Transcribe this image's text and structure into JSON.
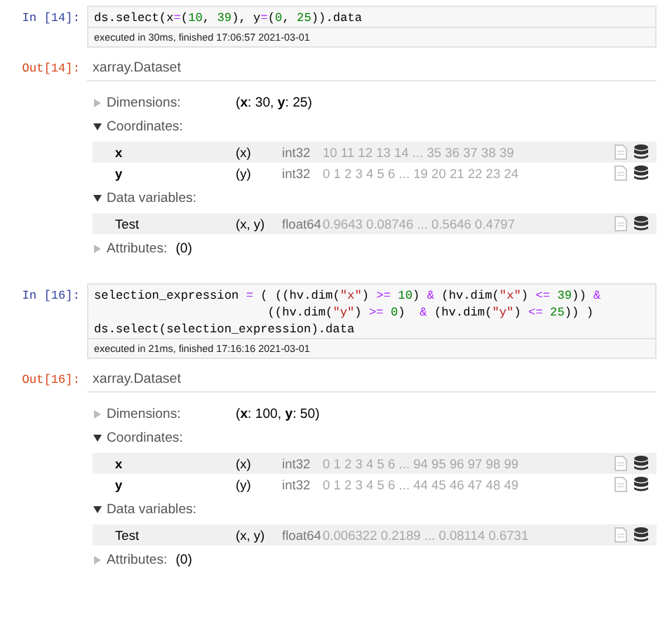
{
  "cells": [
    {
      "input_prompt": "In [14]:",
      "code_lines": [
        [
          {
            "kind": "plain",
            "text": "ds.select(x"
          },
          {
            "kind": "op",
            "text": "="
          },
          {
            "kind": "plain",
            "text": "("
          },
          {
            "kind": "num",
            "text": "10"
          },
          {
            "kind": "plain",
            "text": ", "
          },
          {
            "kind": "num",
            "text": "39"
          },
          {
            "kind": "plain",
            "text": "), y"
          },
          {
            "kind": "op",
            "text": "="
          },
          {
            "kind": "plain",
            "text": "("
          },
          {
            "kind": "num",
            "text": "0"
          },
          {
            "kind": "plain",
            "text": ", "
          },
          {
            "kind": "num",
            "text": "25"
          },
          {
            "kind": "plain",
            "text": ")).data"
          }
        ]
      ],
      "execution_info": "executed in 30ms, finished 17:06:57 2021-03-01",
      "output_prompt": "Out[14]:",
      "dataset": {
        "title": "xarray.Dataset",
        "sections": [
          {
            "kind": "dimensions",
            "label": "Dimensions:",
            "expanded": false,
            "value": "(**x**: 30, **y**: 25)"
          },
          {
            "kind": "coordinates",
            "label": "Coordinates:",
            "expanded": true,
            "rows": [
              {
                "name": "x",
                "dims": "(x)",
                "dtype": "int32",
                "preview": "10 11 12 13 14 ... 35 36 37 38 39"
              },
              {
                "name": "y",
                "dims": "(y)",
                "dtype": "int32",
                "preview": "0 1 2 3 4 5 6 ... 19 20 21 22 23 24"
              }
            ]
          },
          {
            "kind": "data_variables",
            "label": "Data variables:",
            "expanded": true,
            "rows": [
              {
                "name": "Test",
                "dims": "(x, y)",
                "dtype": "float64",
                "preview": "0.9643 0.08746 ... 0.5646 0.4797"
              }
            ]
          },
          {
            "kind": "attributes",
            "label": "Attributes:",
            "expanded": false,
            "value": "(0)"
          }
        ]
      }
    },
    {
      "input_prompt": "In [16]:",
      "code_lines": [
        [
          {
            "kind": "plain",
            "text": "selection_expression "
          },
          {
            "kind": "op",
            "text": "="
          },
          {
            "kind": "plain",
            "text": " ( ((hv.dim("
          },
          {
            "kind": "str",
            "text": "\"x\""
          },
          {
            "kind": "plain",
            "text": ") "
          },
          {
            "kind": "op",
            "text": ">="
          },
          {
            "kind": "num",
            "text": " 10"
          },
          {
            "kind": "plain",
            "text": ") "
          },
          {
            "kind": "op",
            "text": "&"
          },
          {
            "kind": "plain",
            "text": " (hv.dim("
          },
          {
            "kind": "str",
            "text": "\"x\""
          },
          {
            "kind": "plain",
            "text": ") "
          },
          {
            "kind": "op",
            "text": "<="
          },
          {
            "kind": "num",
            "text": " 39"
          },
          {
            "kind": "plain",
            "text": ")) "
          },
          {
            "kind": "op",
            "text": "&"
          }
        ],
        [
          {
            "kind": "plain",
            "text": "                        ((hv.dim("
          },
          {
            "kind": "str",
            "text": "\"y\""
          },
          {
            "kind": "plain",
            "text": ") "
          },
          {
            "kind": "op",
            "text": ">="
          },
          {
            "kind": "num",
            "text": " 0"
          },
          {
            "kind": "plain",
            "text": ")  "
          },
          {
            "kind": "op",
            "text": "&"
          },
          {
            "kind": "plain",
            "text": " (hv.dim("
          },
          {
            "kind": "str",
            "text": "\"y\""
          },
          {
            "kind": "plain",
            "text": ") "
          },
          {
            "kind": "op",
            "text": "<="
          },
          {
            "kind": "num",
            "text": " 25"
          },
          {
            "kind": "plain",
            "text": ")) )"
          }
        ],
        [
          {
            "kind": "plain",
            "text": "ds.select(selection_expression).data"
          }
        ]
      ],
      "execution_info": "executed in 21ms, finished 17:16:16 2021-03-01",
      "output_prompt": "Out[16]:",
      "dataset": {
        "title": "xarray.Dataset",
        "sections": [
          {
            "kind": "dimensions",
            "label": "Dimensions:",
            "expanded": false,
            "value": "(**x**: 100, **y**: 50)"
          },
          {
            "kind": "coordinates",
            "label": "Coordinates:",
            "expanded": true,
            "rows": [
              {
                "name": "x",
                "dims": "(x)",
                "dtype": "int32",
                "preview": "0 1 2 3 4 5 6 ... 94 95 96 97 98 99"
              },
              {
                "name": "y",
                "dims": "(y)",
                "dtype": "int32",
                "preview": "0 1 2 3 4 5 6 ... 44 45 46 47 48 49"
              }
            ]
          },
          {
            "kind": "data_variables",
            "label": "Data variables:",
            "expanded": true,
            "rows": [
              {
                "name": "Test",
                "dims": "(x, y)",
                "dtype": "float64",
                "preview": "0.006322 0.2189 ... 0.08114 0.6731"
              }
            ]
          },
          {
            "kind": "attributes",
            "label": "Attributes:",
            "expanded": false,
            "value": "(0)"
          }
        ]
      }
    }
  ]
}
